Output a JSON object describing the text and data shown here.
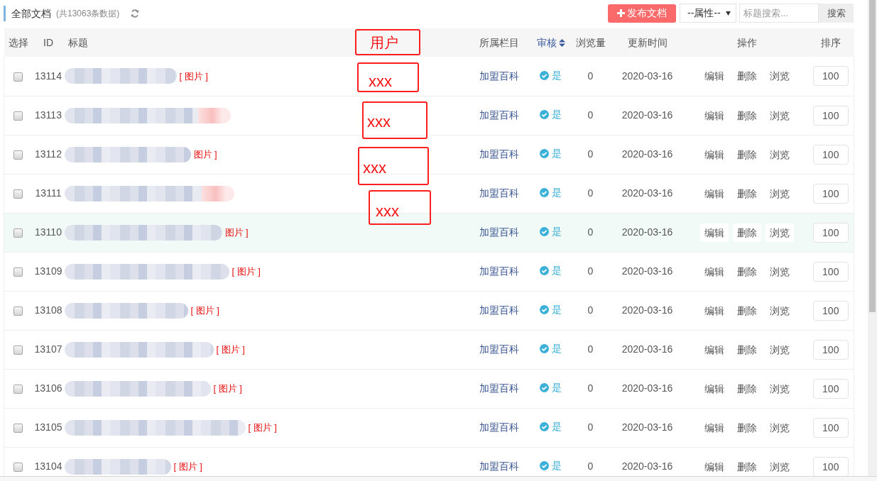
{
  "header": {
    "title": "全部文档",
    "count": "(共13063条数据)",
    "publish_button": "发布文档",
    "attribute_select": "--属性--",
    "search": {
      "placeholder": "标题搜索..."
    },
    "search_button": "搜索"
  },
  "table": {
    "columns": [
      {
        "label": "选择",
        "sortable": false
      },
      {
        "label": "ID",
        "sortable": false
      },
      {
        "label": "标题",
        "sortable": false
      },
      {
        "label": "所属栏目",
        "sortable": false
      },
      {
        "label": "审核",
        "sortable": true
      },
      {
        "label": "浏览量",
        "sortable": false
      },
      {
        "label": "更新时间",
        "sortable": false
      },
      {
        "label": "操作",
        "sortable": false
      },
      {
        "label": "排序",
        "sortable": false
      }
    ],
    "rows": [
      {
        "id": "13114",
        "title_tag": "[ 图片 ]",
        "category": "加盟百科",
        "audit": "是",
        "views": "0",
        "updated": "2020-03-16",
        "actions": [
          "编辑",
          "删除",
          "浏览"
        ],
        "sort": "100",
        "checked": false,
        "hovered": false
      },
      {
        "id": "13113",
        "category": "加盟百科",
        "audit": "是",
        "views": "0",
        "updated": "2020-03-16",
        "actions": [
          "编辑",
          "删除",
          "浏览"
        ],
        "sort": "100",
        "checked": false,
        "hovered": false
      },
      {
        "id": "13112",
        "title_tag": "图片 ]",
        "category": "加盟百科",
        "audit": "是",
        "views": "0",
        "updated": "2020-03-16",
        "actions": [
          "编辑",
          "删除",
          "浏览"
        ],
        "sort": "100",
        "checked": false,
        "hovered": false
      },
      {
        "id": "13111",
        "category": "加盟百科",
        "audit": "是",
        "views": "0",
        "updated": "2020-03-16",
        "actions": [
          "编辑",
          "删除",
          "浏览"
        ],
        "sort": "100",
        "checked": false,
        "hovered": false
      },
      {
        "id": "13110",
        "title_tag": "图片 ]",
        "category": "加盟百科",
        "audit": "是",
        "views": "0",
        "updated": "2020-03-16",
        "actions": [
          "编辑",
          "删除",
          "浏览"
        ],
        "sort": "100",
        "checked": false,
        "hovered": true
      },
      {
        "id": "13109",
        "title_tag": "[ 图片 ]",
        "category": "加盟百科",
        "audit": "是",
        "views": "0",
        "updated": "2020-03-16",
        "actions": [
          "编辑",
          "删除",
          "浏览"
        ],
        "sort": "100",
        "checked": false,
        "hovered": false
      },
      {
        "id": "13108",
        "title_tag": "[ 图片 ]",
        "category": "加盟百科",
        "audit": "是",
        "views": "0",
        "updated": "2020-03-16",
        "actions": [
          "编辑",
          "删除",
          "浏览"
        ],
        "sort": "100",
        "checked": false,
        "hovered": false
      },
      {
        "id": "13107",
        "title_tag": "[ 图片 ]",
        "category": "加盟百科",
        "audit": "是",
        "views": "0",
        "updated": "2020-03-16",
        "actions": [
          "编辑",
          "删除",
          "浏览"
        ],
        "sort": "100",
        "checked": false,
        "hovered": false
      },
      {
        "id": "13106",
        "title_tag": "[ 图片 ]",
        "category": "加盟百科",
        "audit": "是",
        "views": "0",
        "updated": "2020-03-16",
        "actions": [
          "编辑",
          "删除",
          "浏览"
        ],
        "sort": "100",
        "checked": false,
        "hovered": false
      },
      {
        "id": "13105",
        "title_tag": "[ 图片 ]",
        "category": "加盟百科",
        "audit": "是",
        "views": "0",
        "updated": "2020-03-16",
        "actions": [
          "编辑",
          "删除",
          "浏览"
        ],
        "sort": "100",
        "checked": false,
        "hovered": false
      },
      {
        "id": "13104",
        "title_tag": "[ 图片 ]",
        "category": "加盟百科",
        "audit": "是",
        "views": "0",
        "updated": "2020-03-16",
        "actions": [
          "编辑",
          "删除",
          "浏览"
        ],
        "sort": "100",
        "checked": false,
        "hovered": false
      }
    ]
  },
  "annotations": [
    {
      "text": "用户"
    },
    {
      "text": "xxx"
    },
    {
      "text": "xxx"
    },
    {
      "text": "xxx"
    },
    {
      "text": "xxx"
    }
  ]
}
